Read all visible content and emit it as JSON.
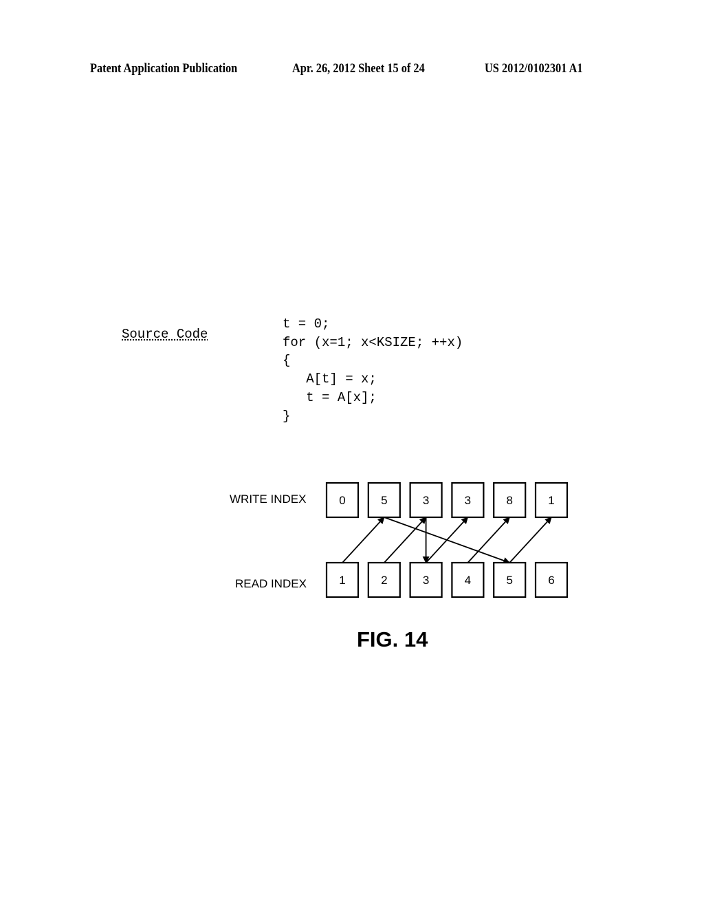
{
  "header": {
    "publication": "Patent Application Publication",
    "date_sheet": "Apr. 26, 2012  Sheet 15 of 24",
    "number": "US 2012/0102301 A1"
  },
  "source_code": {
    "label": "Source Code",
    "lines": [
      "t = 0;",
      "for (x=1; x<KSIZE; ++x)",
      "{",
      "   A[t] = x;",
      "   t = A[x];",
      "}"
    ]
  },
  "diagram": {
    "write_label": "WRITE INDEX",
    "read_label": "READ INDEX",
    "write_values": [
      "0",
      "5",
      "3",
      "3",
      "8",
      "1"
    ],
    "read_values": [
      "1",
      "2",
      "3",
      "4",
      "5",
      "6"
    ],
    "arrows": [
      {
        "from": "read",
        "from_index": 0,
        "to": "write",
        "to_index": 1
      },
      {
        "from": "read",
        "from_index": 1,
        "to": "write",
        "to_index": 2
      },
      {
        "from": "write",
        "from_index": 2,
        "to": "read",
        "to_index": 2
      },
      {
        "from": "read",
        "from_index": 2,
        "to": "write",
        "to_index": 3
      },
      {
        "from": "read",
        "from_index": 3,
        "to": "write",
        "to_index": 4
      },
      {
        "from": "write",
        "from_index": 1,
        "to": "read",
        "to_index": 4
      },
      {
        "from": "read",
        "from_index": 4,
        "to": "write",
        "to_index": 5
      }
    ]
  },
  "figure_label": "FIG. 14"
}
